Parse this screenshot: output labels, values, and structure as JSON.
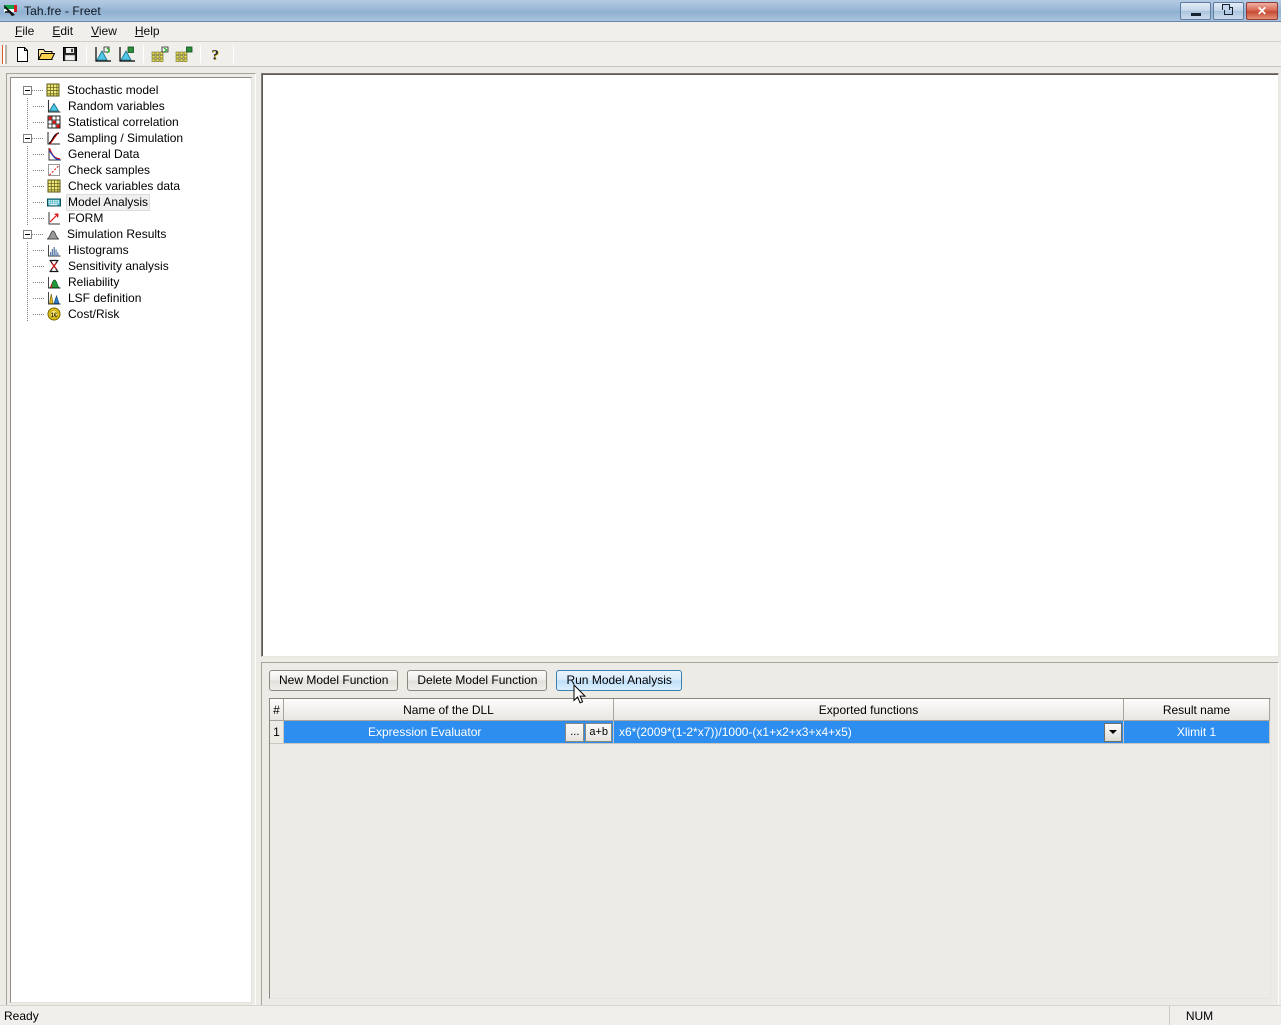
{
  "window": {
    "title": "Tah.fre - Freet",
    "app_icon": "freet-logo-icon",
    "minimize_label": "Minimize",
    "restore_label": "Restore",
    "close_label": "Close"
  },
  "menu": {
    "items": [
      {
        "label": "File",
        "accel": "F"
      },
      {
        "label": "Edit",
        "accel": "E"
      },
      {
        "label": "View",
        "accel": "V"
      },
      {
        "label": "Help",
        "accel": "H"
      }
    ]
  },
  "toolbar": {
    "buttons": [
      {
        "name": "new-document-icon",
        "tooltip": "New"
      },
      {
        "name": "open-folder-icon",
        "tooltip": "Open"
      },
      {
        "name": "save-disk-icon",
        "tooltip": "Save"
      },
      {
        "name": "import-distribution-icon",
        "tooltip": "Import samples"
      },
      {
        "name": "export-distribution-icon",
        "tooltip": "Export samples"
      },
      {
        "name": "import-grid-icon",
        "tooltip": "Import data"
      },
      {
        "name": "export-grid-icon",
        "tooltip": "Export data"
      },
      {
        "name": "help-question-icon",
        "tooltip": "Help"
      }
    ]
  },
  "tree": {
    "nodes": [
      {
        "label": "Stochastic model",
        "level": 0,
        "icon": "grid-yellow-icon",
        "expander": "minus",
        "selected": false
      },
      {
        "label": "Random variables",
        "level": 1,
        "icon": "distribution-blue-icon",
        "expander": "none",
        "selected": false
      },
      {
        "label": "Statistical correlation",
        "level": 1,
        "icon": "correlation-grid-icon",
        "expander": "none",
        "selected": false
      },
      {
        "label": "Sampling / Simulation",
        "level": 0,
        "icon": "curve-axes-icon",
        "expander": "minus",
        "selected": false
      },
      {
        "label": "General Data",
        "level": 1,
        "icon": "decay-curve-icon",
        "expander": "none",
        "selected": false
      },
      {
        "label": "Check samples",
        "level": 1,
        "icon": "scatter-line-icon",
        "expander": "none",
        "selected": false
      },
      {
        "label": "Check variables data",
        "level": 1,
        "icon": "grid-yellow-icon",
        "expander": "none",
        "selected": false
      },
      {
        "label": "Model Analysis",
        "level": 1,
        "icon": "keyboard-teal-icon",
        "expander": "none",
        "selected": true
      },
      {
        "label": "FORM",
        "level": 1,
        "icon": "form-arrow-icon",
        "expander": "none",
        "selected": false
      },
      {
        "label": "Simulation Results",
        "level": 0,
        "icon": "grey-hill-icon",
        "expander": "minus",
        "selected": false
      },
      {
        "label": "Histograms",
        "level": 1,
        "icon": "histogram-bars-icon",
        "expander": "none",
        "selected": false
      },
      {
        "label": "Sensitivity analysis",
        "level": 1,
        "icon": "hourglass-icon",
        "expander": "none",
        "selected": false
      },
      {
        "label": "Reliability",
        "level": 1,
        "icon": "reliability-hill-icon",
        "expander": "none",
        "selected": false
      },
      {
        "label": "LSF definition",
        "level": 1,
        "icon": "lsf-peaks-icon",
        "expander": "none",
        "selected": false
      },
      {
        "label": "Cost/Risk",
        "level": 1,
        "icon": "euro-coin-icon",
        "expander": "none",
        "selected": false
      }
    ]
  },
  "model_analysis": {
    "buttons": {
      "new": "New Model Function",
      "delete": "Delete Model Function",
      "run": "Run Model Analysis"
    },
    "grid": {
      "headers": {
        "num": "#",
        "dll": "Name of the DLL",
        "exported": "Exported functions",
        "result": "Result name"
      },
      "rows": [
        {
          "num": "1",
          "dll": "Expression Evaluator",
          "browse_label": "...",
          "expr_label": "a+b",
          "exported": "x6*(2009*(1-2*x7))/1000-(x1+x2+x3+x4+x5)",
          "result": "Xlimit 1"
        }
      ]
    }
  },
  "statusbar": {
    "message": "Ready",
    "num_indicator": "NUM"
  },
  "colors": {
    "selection": "#2e8ef0",
    "title_gradient_top": "#b5cbe4",
    "title_gradient_bottom": "#a9c3dd",
    "close_button": "#c44a33",
    "panel_face": "#edebe6"
  }
}
